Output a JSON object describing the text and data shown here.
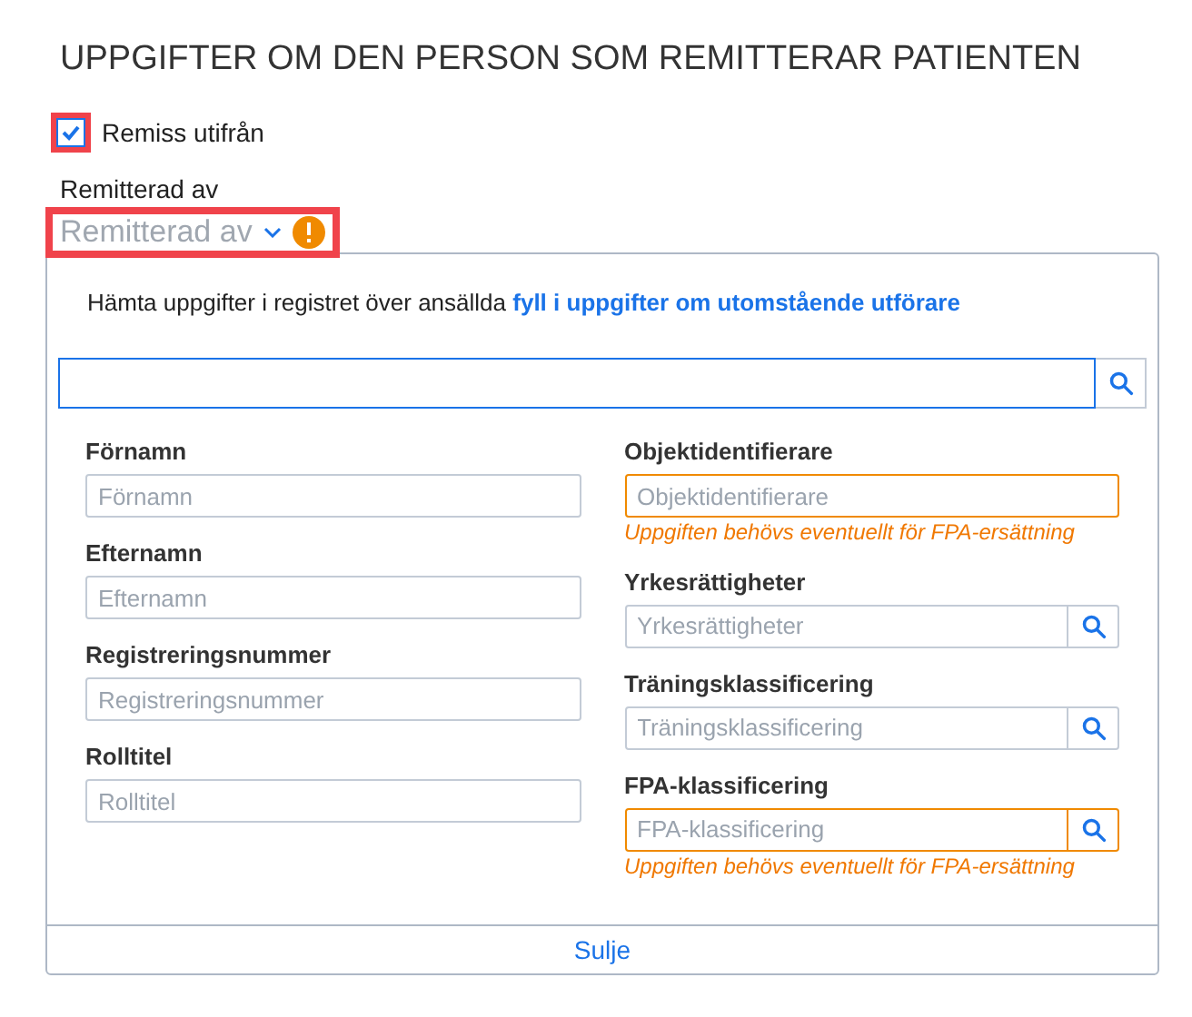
{
  "title": "UPPGIFTER OM DEN PERSON SOM REMITTERAR PATIENTEN",
  "checkbox": {
    "label": "Remiss utifrån",
    "checked": true,
    "highlighted": true
  },
  "referrer": {
    "label": "Remitterad av",
    "placeholder": "Remitterad av",
    "highlighted": true,
    "warning": true
  },
  "panel": {
    "intro": "Hämta uppgifter i registret över ansällda",
    "link": "fyll i uppgifter om utomstående utförare",
    "left_fields": [
      {
        "kind": "text",
        "label": "Förnamn",
        "placeholder": "Förnamn",
        "warning": false
      },
      {
        "kind": "text",
        "label": "Efternamn",
        "placeholder": "Efternamn",
        "warning": false
      },
      {
        "kind": "text",
        "label": "Registreringsnummer",
        "placeholder": "Registreringsnummer",
        "warning": false
      },
      {
        "kind": "text",
        "label": "Rolltitel",
        "placeholder": "Rolltitel",
        "warning": false
      }
    ],
    "right_fields": [
      {
        "kind": "text",
        "label": "Objektidentifierare",
        "placeholder": "Objektidentifierare",
        "warning": true,
        "hint": "Uppgiften behövs eventuellt för FPA-ersättning"
      },
      {
        "kind": "search",
        "label": "Yrkesrättigheter",
        "placeholder": "Yrkesrättigheter",
        "warning": false
      },
      {
        "kind": "search",
        "label": "Träningsklassificering",
        "placeholder": "Träningsklassificering",
        "warning": false
      },
      {
        "kind": "search",
        "label": "FPA-klassificering",
        "placeholder": "FPA-klassificering",
        "warning": true,
        "hint": "Uppgiften behövs eventuellt för FPA-ersättning"
      }
    ],
    "close": "Sulje"
  }
}
